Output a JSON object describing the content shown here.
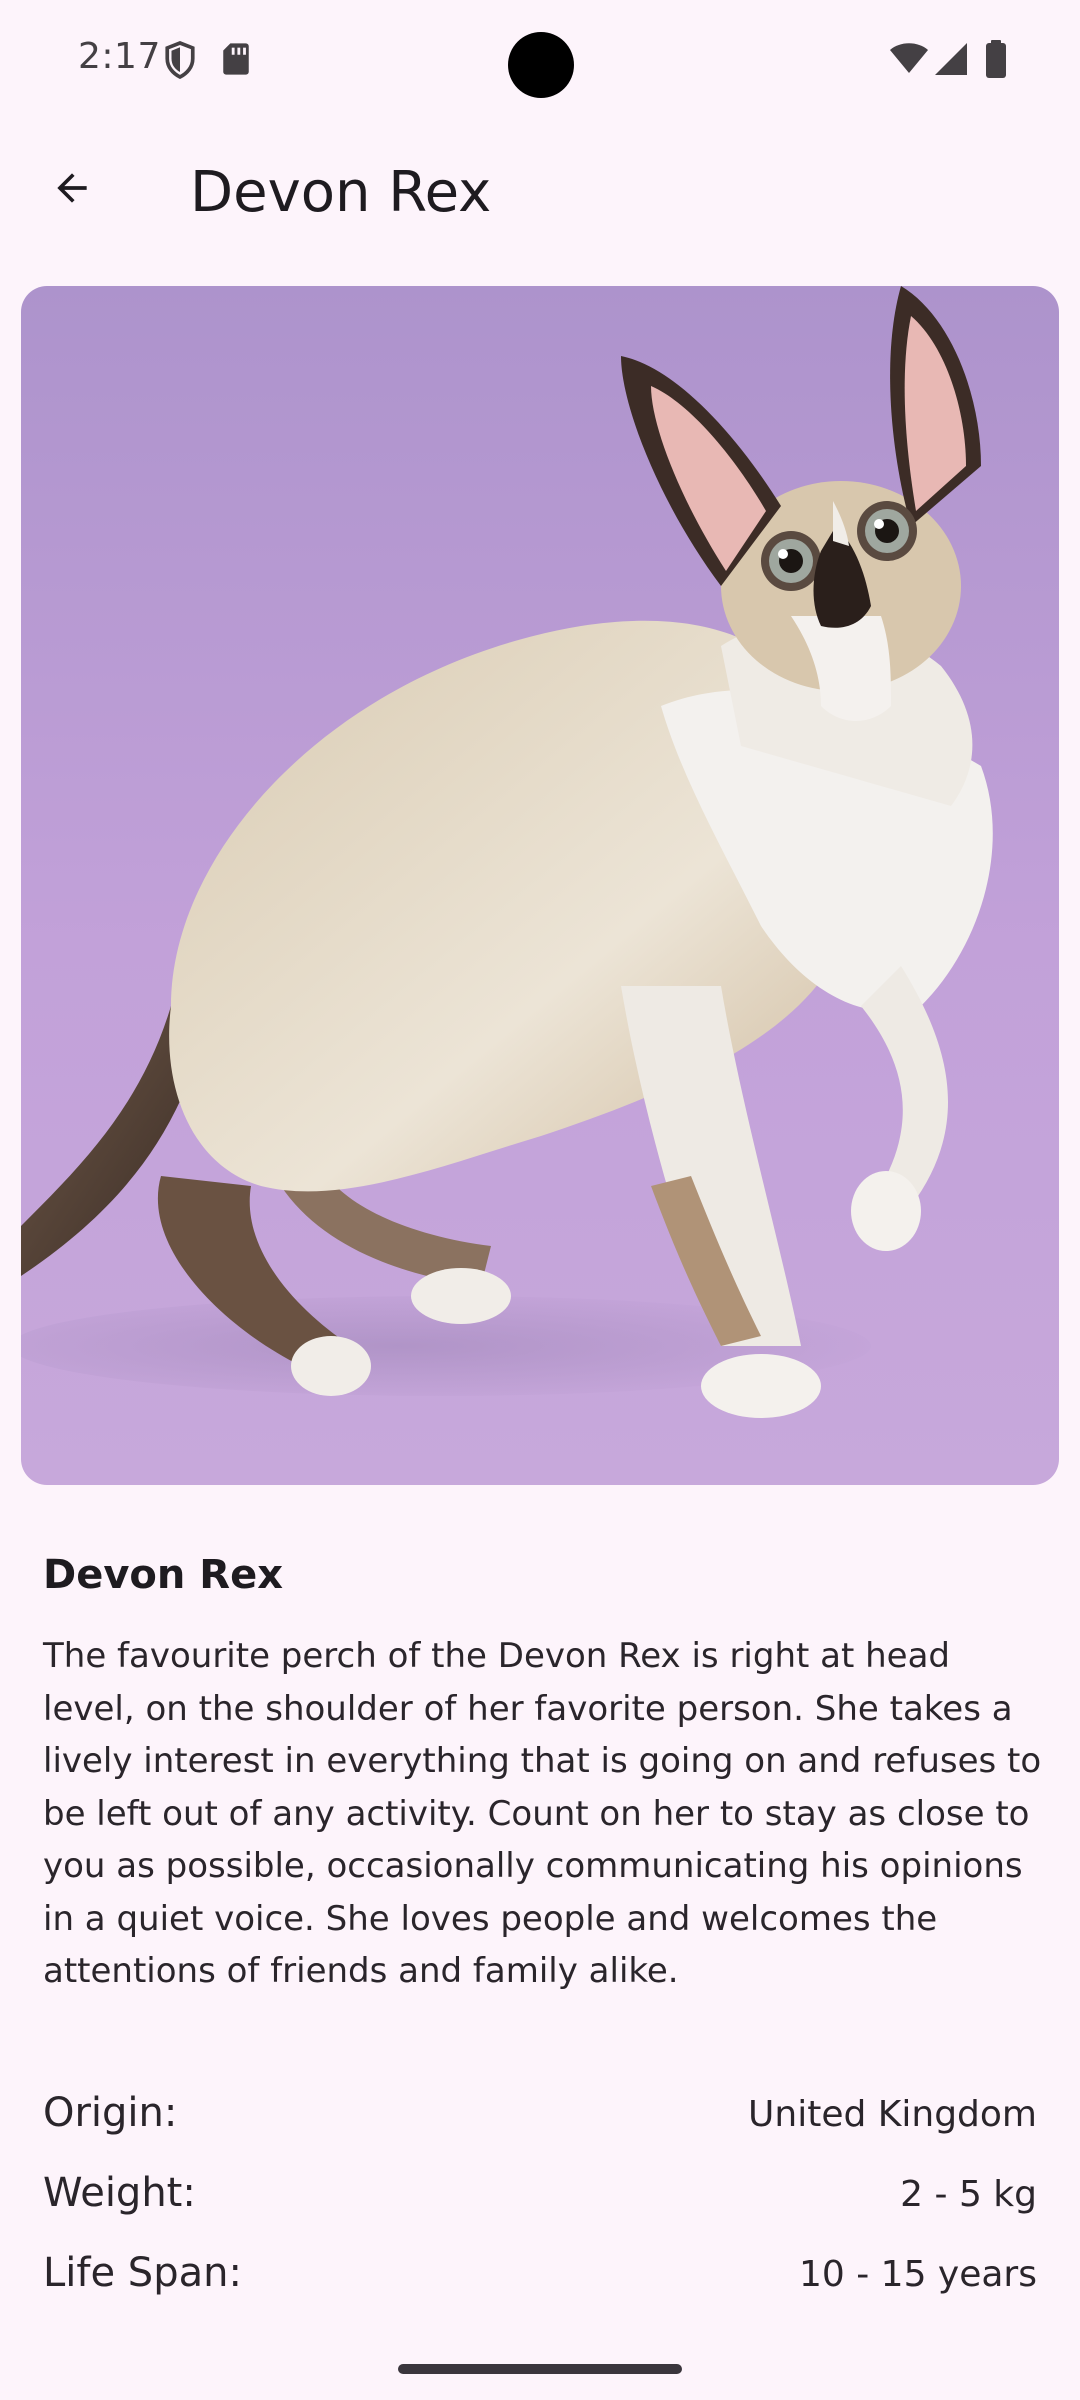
{
  "status_bar": {
    "time": "2:17",
    "icons": [
      "shield-icon",
      "sd-card-icon",
      "wifi-icon",
      "cell-signal-icon",
      "battery-icon"
    ]
  },
  "app_bar": {
    "back_icon": "arrow-back-icon",
    "title": "Devon Rex"
  },
  "hero_image": {
    "subject": "cat-photo",
    "background_color": "#b89ad3"
  },
  "breed": {
    "name": "Devon Rex",
    "description": "The favourite perch of the Devon Rex is right at head level, on the shoulder of her favorite person. She takes a lively interest in everything that is going on and refuses to be left out of any activity. Count on her to stay as close to you as possible, occasionally communicating his opinions in a quiet voice. She loves people and welcomes the attentions of friends and family alike.",
    "details": [
      {
        "label": "Origin:",
        "value": "United Kingdom"
      },
      {
        "label": "Weight:",
        "value": "2 - 5 kg"
      },
      {
        "label": "Life Span:",
        "value": "10 - 15 years"
      }
    ]
  },
  "colors": {
    "background": "#fdf4fb",
    "text": "#1e1b20"
  }
}
